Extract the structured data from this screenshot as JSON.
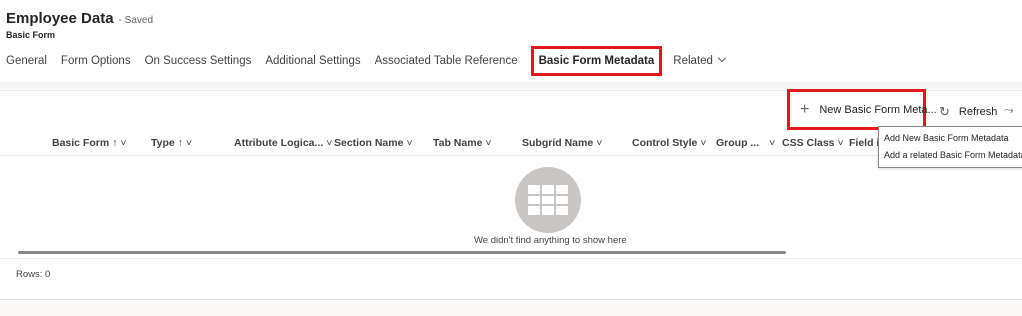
{
  "header": {
    "title": "Employee Data",
    "status": "- Saved",
    "subtitle": "Basic Form"
  },
  "tabs": [
    {
      "label": "General"
    },
    {
      "label": "Form Options"
    },
    {
      "label": "On Success Settings"
    },
    {
      "label": "Additional Settings"
    },
    {
      "label": "Associated Table Reference"
    },
    {
      "label": "Basic Form Metadata",
      "active": true
    },
    {
      "label": "Related"
    }
  ],
  "commandbar": {
    "new_label": "New Basic Form Meta...",
    "new_icon": "plus-icon",
    "refresh_label": "Refresh",
    "refresh_icon": "refresh-icon",
    "more_icon": "flow-icon"
  },
  "tooltip": {
    "line1": "Add New Basic Form Metadata",
    "line2": "Add a related Basic Form Metadata to t"
  },
  "grid": {
    "columns": [
      {
        "label": "Basic Form",
        "arrow": "↑ ˅"
      },
      {
        "label": "Type",
        "arrow": "↑ ˅"
      },
      {
        "label": "Attribute Logica...",
        "arrow": "˅"
      },
      {
        "label": "Section Name",
        "arrow": "˅"
      },
      {
        "label": "Tab Name",
        "arrow": "˅"
      },
      {
        "label": "Subgrid Name",
        "arrow": "˅"
      },
      {
        "label": "Control Style",
        "arrow": "˅"
      },
      {
        "label": "Group ...",
        "arrow": "˅"
      },
      {
        "label": "CSS Class",
        "arrow": "˅"
      },
      {
        "label": "Field is",
        "arrow": ""
      }
    ],
    "empty_message": "We didn't find anything to show here",
    "rows_label": "Rows: 0"
  },
  "colors": {
    "highlight": "#e0171c",
    "empty_icon": "#c8c6c4"
  }
}
